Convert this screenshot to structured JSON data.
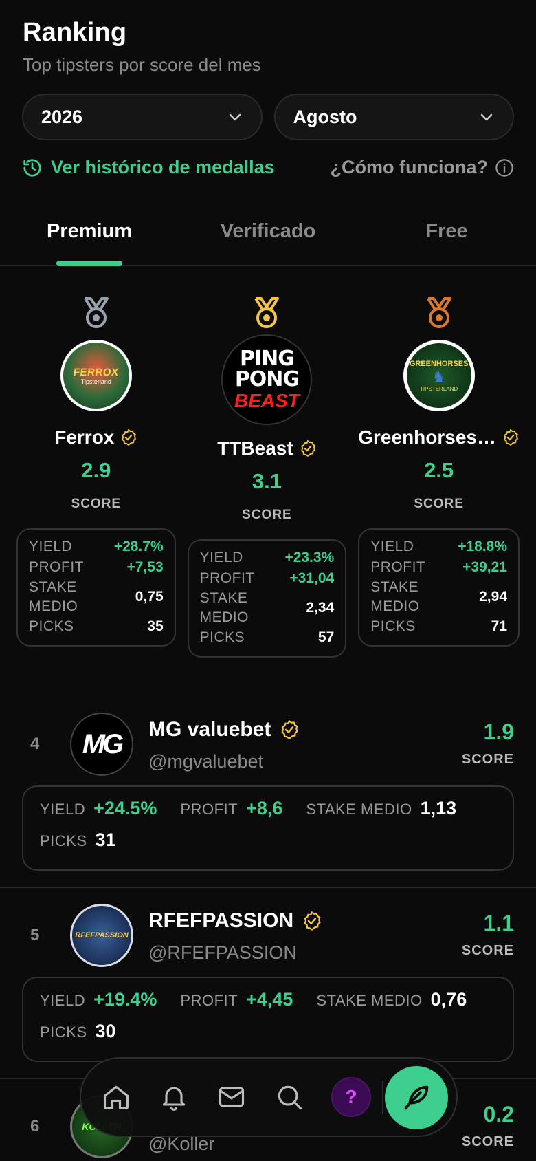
{
  "header": {
    "title": "Ranking",
    "subtitle": "Top tipsters por score del mes"
  },
  "filters": {
    "year": "2026",
    "month": "Agosto"
  },
  "links": {
    "history": "Ver histórico de medallas",
    "how": "¿Cómo funciona?"
  },
  "tabs": [
    {
      "label": "Premium",
      "active": true
    },
    {
      "label": "Verificado",
      "active": false
    },
    {
      "label": "Free",
      "active": false
    }
  ],
  "podium": [
    {
      "rank": 2,
      "medal": "silver-medal-icon",
      "name": "Ferrox",
      "score": "2.9",
      "score_label": "SCORE",
      "avatar_text": "FERROX",
      "avatar_sub": "Tipsterland",
      "stats": {
        "yield_label": "YIELD",
        "yield": "+28.7%",
        "profit_label": "PROFIT",
        "profit": "+7,53",
        "stake_label_1": "STAKE",
        "stake_label_2": "MEDIO",
        "stake": "0,75",
        "picks_label": "PICKS",
        "picks": "35"
      }
    },
    {
      "rank": 1,
      "medal": "gold-medal-icon",
      "name": "TTBeast",
      "score": "3.1",
      "score_label": "SCORE",
      "avatar_text": "PING PONG",
      "avatar_sub": "BEAST",
      "stats": {
        "yield_label": "YIELD",
        "yield": "+23.3%",
        "profit_label": "PROFIT",
        "profit": "+31,04",
        "stake_label_1": "STAKE",
        "stake_label_2": "MEDIO",
        "stake": "2,34",
        "picks_label": "PICKS",
        "picks": "57"
      }
    },
    {
      "rank": 3,
      "medal": "bronze-medal-icon",
      "name": "Greenhorses…",
      "score": "2.5",
      "score_label": "SCORE",
      "avatar_text": "GREENHORSES",
      "avatar_sub": "TIPSTERLAND",
      "stats": {
        "yield_label": "YIELD",
        "yield": "+18.8%",
        "profit_label": "PROFIT",
        "profit": "+39,21",
        "stake_label_1": "STAKE",
        "stake_label_2": "MEDIO",
        "stake": "2,94",
        "picks_label": "PICKS",
        "picks": "71"
      }
    }
  ],
  "ranking": [
    {
      "rank": "4",
      "name": "MG valuebet",
      "handle": "@mgvaluebet",
      "score": "1.9",
      "score_label": "SCORE",
      "avatar_text": "MG",
      "yield_label": "YIELD",
      "yield": "+24.5%",
      "profit_label": "PROFIT",
      "profit": "+8,6",
      "stake_label": "STAKE MEDIO",
      "stake": "1,13",
      "picks_label": "PICKS",
      "picks": "31"
    },
    {
      "rank": "5",
      "name": "RFEFPASSION",
      "handle": "@RFEFPASSION",
      "score": "1.1",
      "score_label": "SCORE",
      "avatar_text": "RFEFPASSION",
      "yield_label": "YIELD",
      "yield": "+19.4%",
      "profit_label": "PROFIT",
      "profit": "+4,45",
      "stake_label": "STAKE MEDIO",
      "stake": "0,76",
      "picks_label": "PICKS",
      "picks": "30"
    },
    {
      "rank": "6",
      "handle": "@Koller",
      "score": "0.2",
      "score_label": "SCORE",
      "avatar_text": "KOLLER"
    }
  ],
  "bottom_nav": {
    "icons": [
      "home-icon",
      "bell-icon",
      "mail-icon",
      "search-icon"
    ],
    "help": "?",
    "fab_icon": "feather-icon"
  },
  "colors": {
    "accent": "#3ecf8e",
    "background": "#0b0b0b",
    "gold": "#f5c542",
    "silver": "#9aa3ad",
    "bronze": "#d9782f",
    "help_purple": "#e04aff"
  }
}
